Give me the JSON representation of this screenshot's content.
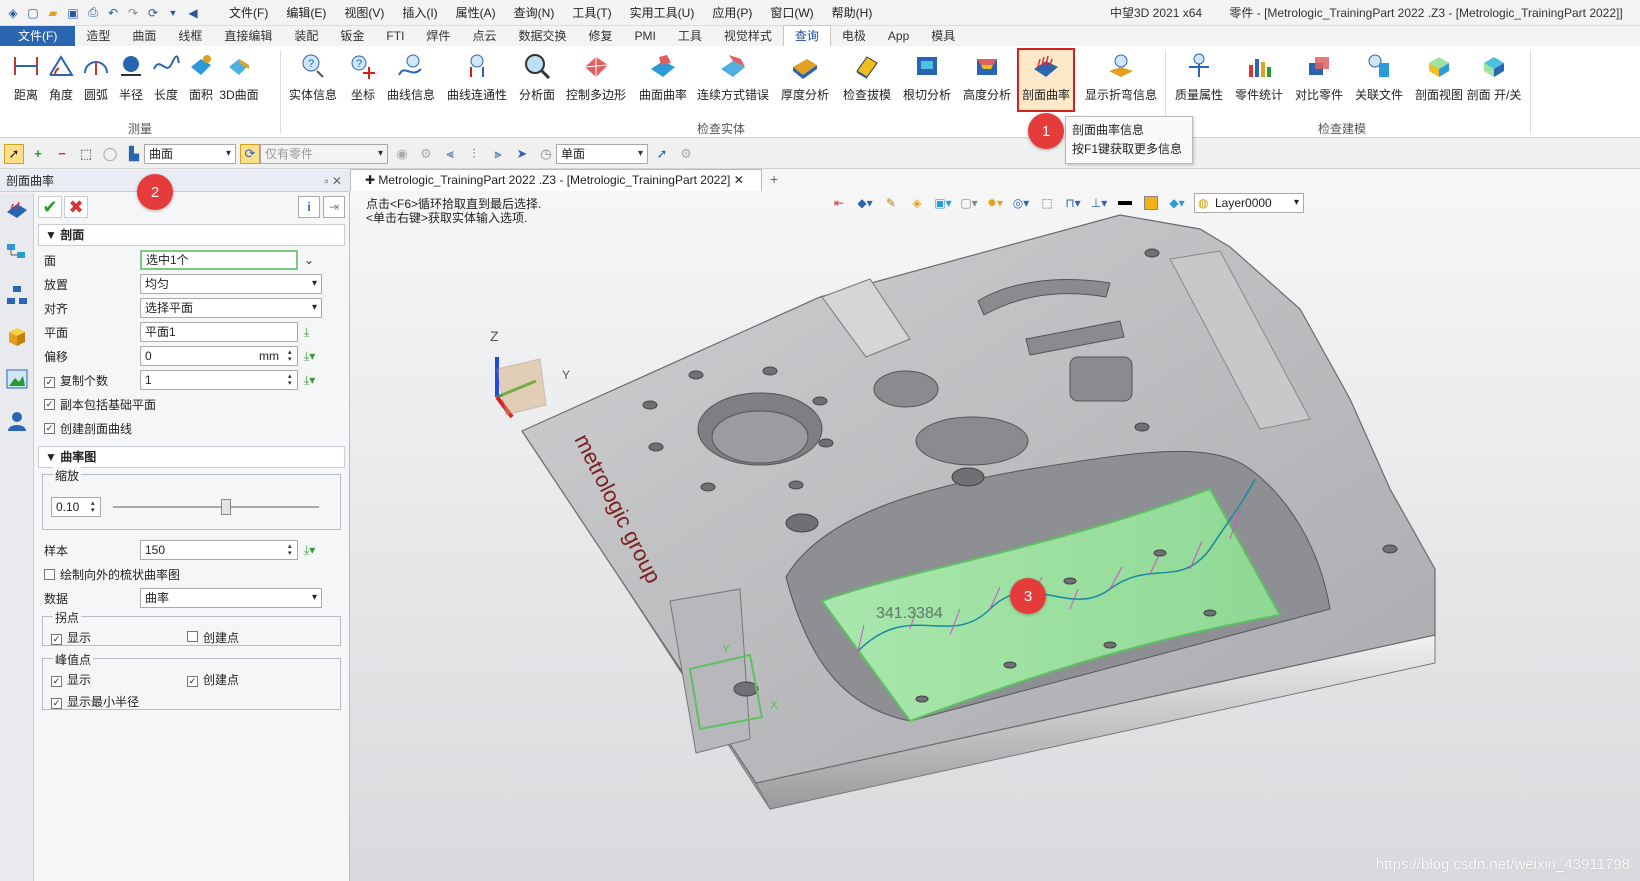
{
  "titlebar": {
    "menu": [
      "文件(F)",
      "编辑(E)",
      "视图(V)",
      "插入(I)",
      "属性(A)",
      "查询(N)",
      "工具(T)",
      "实用工具(U)",
      "应用(P)",
      "窗口(W)",
      "帮助(H)"
    ],
    "app_name": "中望3D 2021 x64",
    "doc_title": "零件 - [Metrologic_TrainingPart  2022 .Z3 - [Metrologic_TrainingPart  2022]]"
  },
  "tabs": [
    "文件(F)",
    "造型",
    "曲面",
    "线框",
    "直接编辑",
    "装配",
    "钣金",
    "FTI",
    "焊件",
    "点云",
    "数据交换",
    "修复",
    "PMI",
    "工具",
    "视觉样式",
    "查询",
    "电极",
    "App",
    "模具"
  ],
  "ribbon": {
    "measure": {
      "label": "测量",
      "buttons": [
        "距离",
        "角度",
        "圆弧",
        "半径",
        "长度",
        "面积",
        "3D曲面"
      ]
    },
    "inspect": {
      "label": "检查实体",
      "buttons": [
        "实体信息",
        "坐标",
        "曲线信息",
        "曲线连通性",
        "分析面",
        "控制多边形",
        "曲面曲率",
        "连续方式错误",
        "厚度分析",
        "检查拔模",
        "根切分析",
        "高度分析",
        "剖面曲率",
        "显示折弯信息"
      ]
    },
    "model": {
      "label": "检查建模",
      "buttons": [
        "质量属性",
        "零件统计",
        "对比零件",
        "关联文件",
        "剖面视图",
        "剖面 开/关"
      ]
    }
  },
  "tooltip": {
    "line1": "剖面曲率信息",
    "line2": "按F1键获取更多信息"
  },
  "badges": [
    "1",
    "2",
    "3"
  ],
  "filterbar": {
    "filter_value": "曲面",
    "part_value": "仅有零件",
    "mode_value": "单面"
  },
  "panel": {
    "title": "剖面曲率",
    "section1": "剖面",
    "face": {
      "label": "面",
      "value": "选中1个"
    },
    "placement": {
      "label": "放置",
      "value": "均匀"
    },
    "align": {
      "label": "对齐",
      "value": "选择平面"
    },
    "plane": {
      "label": "平面",
      "value": "平面1"
    },
    "offset": {
      "label": "偏移",
      "value": "0",
      "unit": "mm"
    },
    "copies": {
      "label": "复制个数",
      "value": "1"
    },
    "include_base": "副本包括基础平面",
    "create_curve": "创建剖面曲线",
    "section2": "曲率图",
    "scale": {
      "label": "缩放",
      "value": "0.10",
      "slider_fraction": 0.55
    },
    "samples": {
      "label": "样本",
      "value": "150"
    },
    "mirror": "绘制向外的梳状曲率图",
    "data": {
      "label": "数据",
      "value": "曲率"
    },
    "inflection": {
      "legend": "拐点",
      "show": "显示",
      "create": "创建点"
    },
    "peak": {
      "legend": "峰值点",
      "show": "显示",
      "create": "创建点",
      "min_radius": "显示最小半径"
    }
  },
  "viewport": {
    "doc_tab": "Metrologic_TrainingPart  2022 .Z3 - [Metrologic_TrainingPart  2022]",
    "hint1": "点击<F6>循环拾取直到最后选择.",
    "hint2": "<单击右键>获取实体输入选项.",
    "layer": "Layer0000",
    "radius_readout": "341.3384",
    "brand_text": "metrologic group",
    "axis_z": "Z",
    "axis_y": "Y",
    "axis_x": "X",
    "watermark": "https://blog.csdn.net/weixin_43911798"
  },
  "colors": {
    "accent": "#2a65b2",
    "badge": "#e63b3b",
    "highlight_border": "#d62020",
    "selected_face": "#9fe3a3"
  }
}
